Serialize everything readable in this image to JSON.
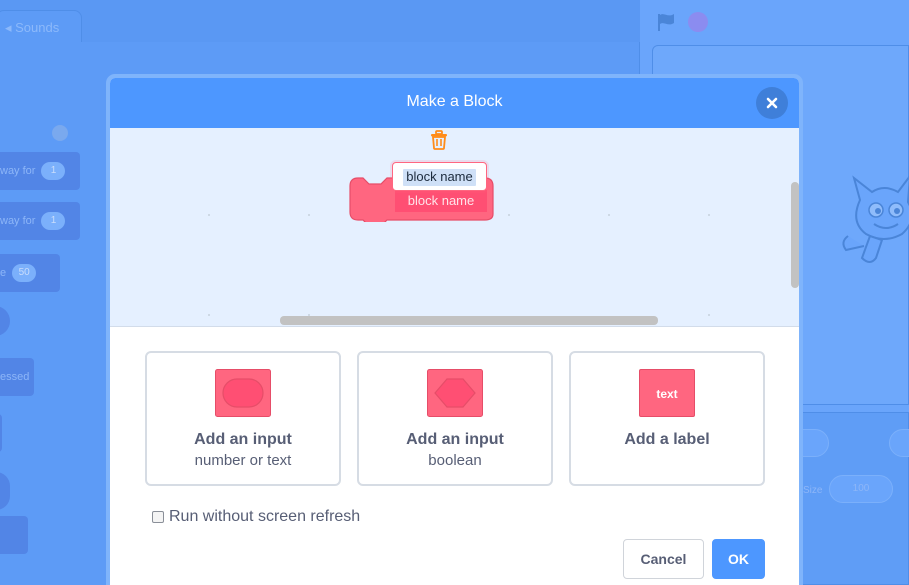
{
  "background": {
    "tab_sounds": "Sounds",
    "blocks": [
      {
        "text": "way for",
        "value": "1"
      },
      {
        "text": "way for",
        "value": "1"
      },
      {
        "text": "e",
        "value": "50"
      },
      {
        "text": "essed",
        "value": ""
      }
    ],
    "sprite_fields": [
      "Size",
      "100"
    ]
  },
  "modal": {
    "title": "Make a Block",
    "close_icon": "close-icon",
    "trash_icon": "trash-icon",
    "block_name_value": "block name",
    "block_label": "block name",
    "options": [
      {
        "title": "Add an input",
        "subtitle": "number or text",
        "icon": "number-input-icon"
      },
      {
        "title": "Add an input",
        "subtitle": "boolean",
        "icon": "boolean-input-icon"
      },
      {
        "title": "Add a label",
        "subtitle": "",
        "icon": "label-icon",
        "icon_text": "text"
      }
    ],
    "checkbox_label": "Run without screen refresh",
    "checkbox_checked": false,
    "cancel_label": "Cancel",
    "ok_label": "OK"
  },
  "colors": {
    "accent": "#4d97ff",
    "block_pink": "#ff6680"
  }
}
